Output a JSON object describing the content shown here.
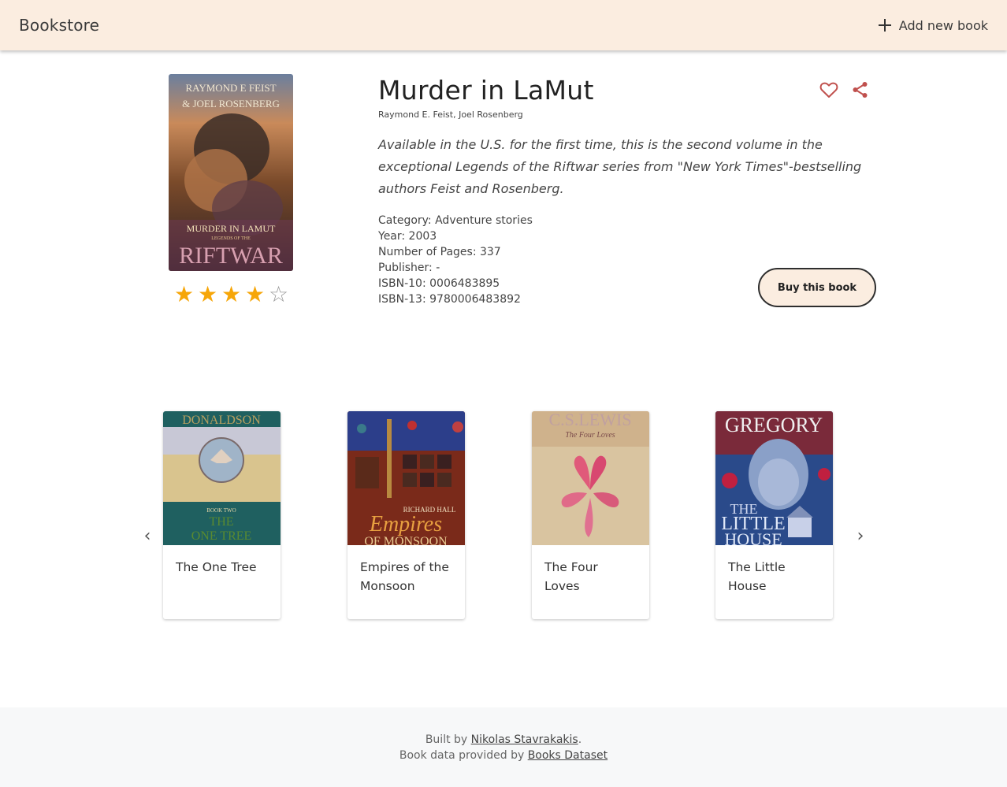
{
  "header": {
    "brand": "Bookstore",
    "add_label": "Add new book"
  },
  "book": {
    "title": "Murder in LaMut",
    "authors": "Raymond E. Feist, Joel Rosenberg",
    "description": "Available in the U.S. for the first time, this is the second volume in the exceptional Legends of the Riftwar series from \"New York Times\"-bestselling authors Feist and Rosenberg.",
    "category": "Category: Adventure stories",
    "year": "Year: 2003",
    "pages": "Number of Pages: 337",
    "publisher": "Publisher: -",
    "isbn10": "ISBN-10: 0006483895",
    "isbn13": "ISBN-13: 9780006483892",
    "rating": 4,
    "rating_max": 5,
    "buy_label": "Buy this book",
    "cover": {
      "author_line1": "RAYMOND E FEIST",
      "author_line2": "& JOEL ROSENBERG",
      "title_line": "MURDER IN LAMUT",
      "series_line": "LEGENDS OF THE",
      "series_name": "RIFTWAR"
    }
  },
  "related": [
    {
      "title": "The One Tree",
      "cover_top": "DONALDSON",
      "cover_mid": "BOOK TWO",
      "cover_bottom1": "THE",
      "cover_bottom2": "ONE TREE"
    },
    {
      "title": "Empires of the Monsoon",
      "cover_top": "RICHARD HALL",
      "cover_mid": "Empires",
      "cover_bottom1": "OF MONSOON"
    },
    {
      "title": "The Four Loves",
      "cover_top": "C.S.LEWIS",
      "cover_mid": "The Four Loves"
    },
    {
      "title": "The Little House",
      "cover_top": "GREGORY",
      "cover_mid": "THE",
      "cover_bottom1": "LITTLE",
      "cover_bottom2": "HOUSE"
    }
  ],
  "carousel": {
    "prev_icon": "chevron-left-icon",
    "next_icon": "chevron-right-icon"
  },
  "footer": {
    "built_prefix": "Built by ",
    "author_link": "Nikolas Stavrakakis",
    "built_suffix": ".",
    "data_prefix": "Book data provided by ",
    "data_link": "Books Dataset"
  },
  "colors": {
    "header_bg": "#fbede0",
    "accent_icon": "#c0504d",
    "star": "#f6a609",
    "footer_bg": "#f7f8f9"
  }
}
